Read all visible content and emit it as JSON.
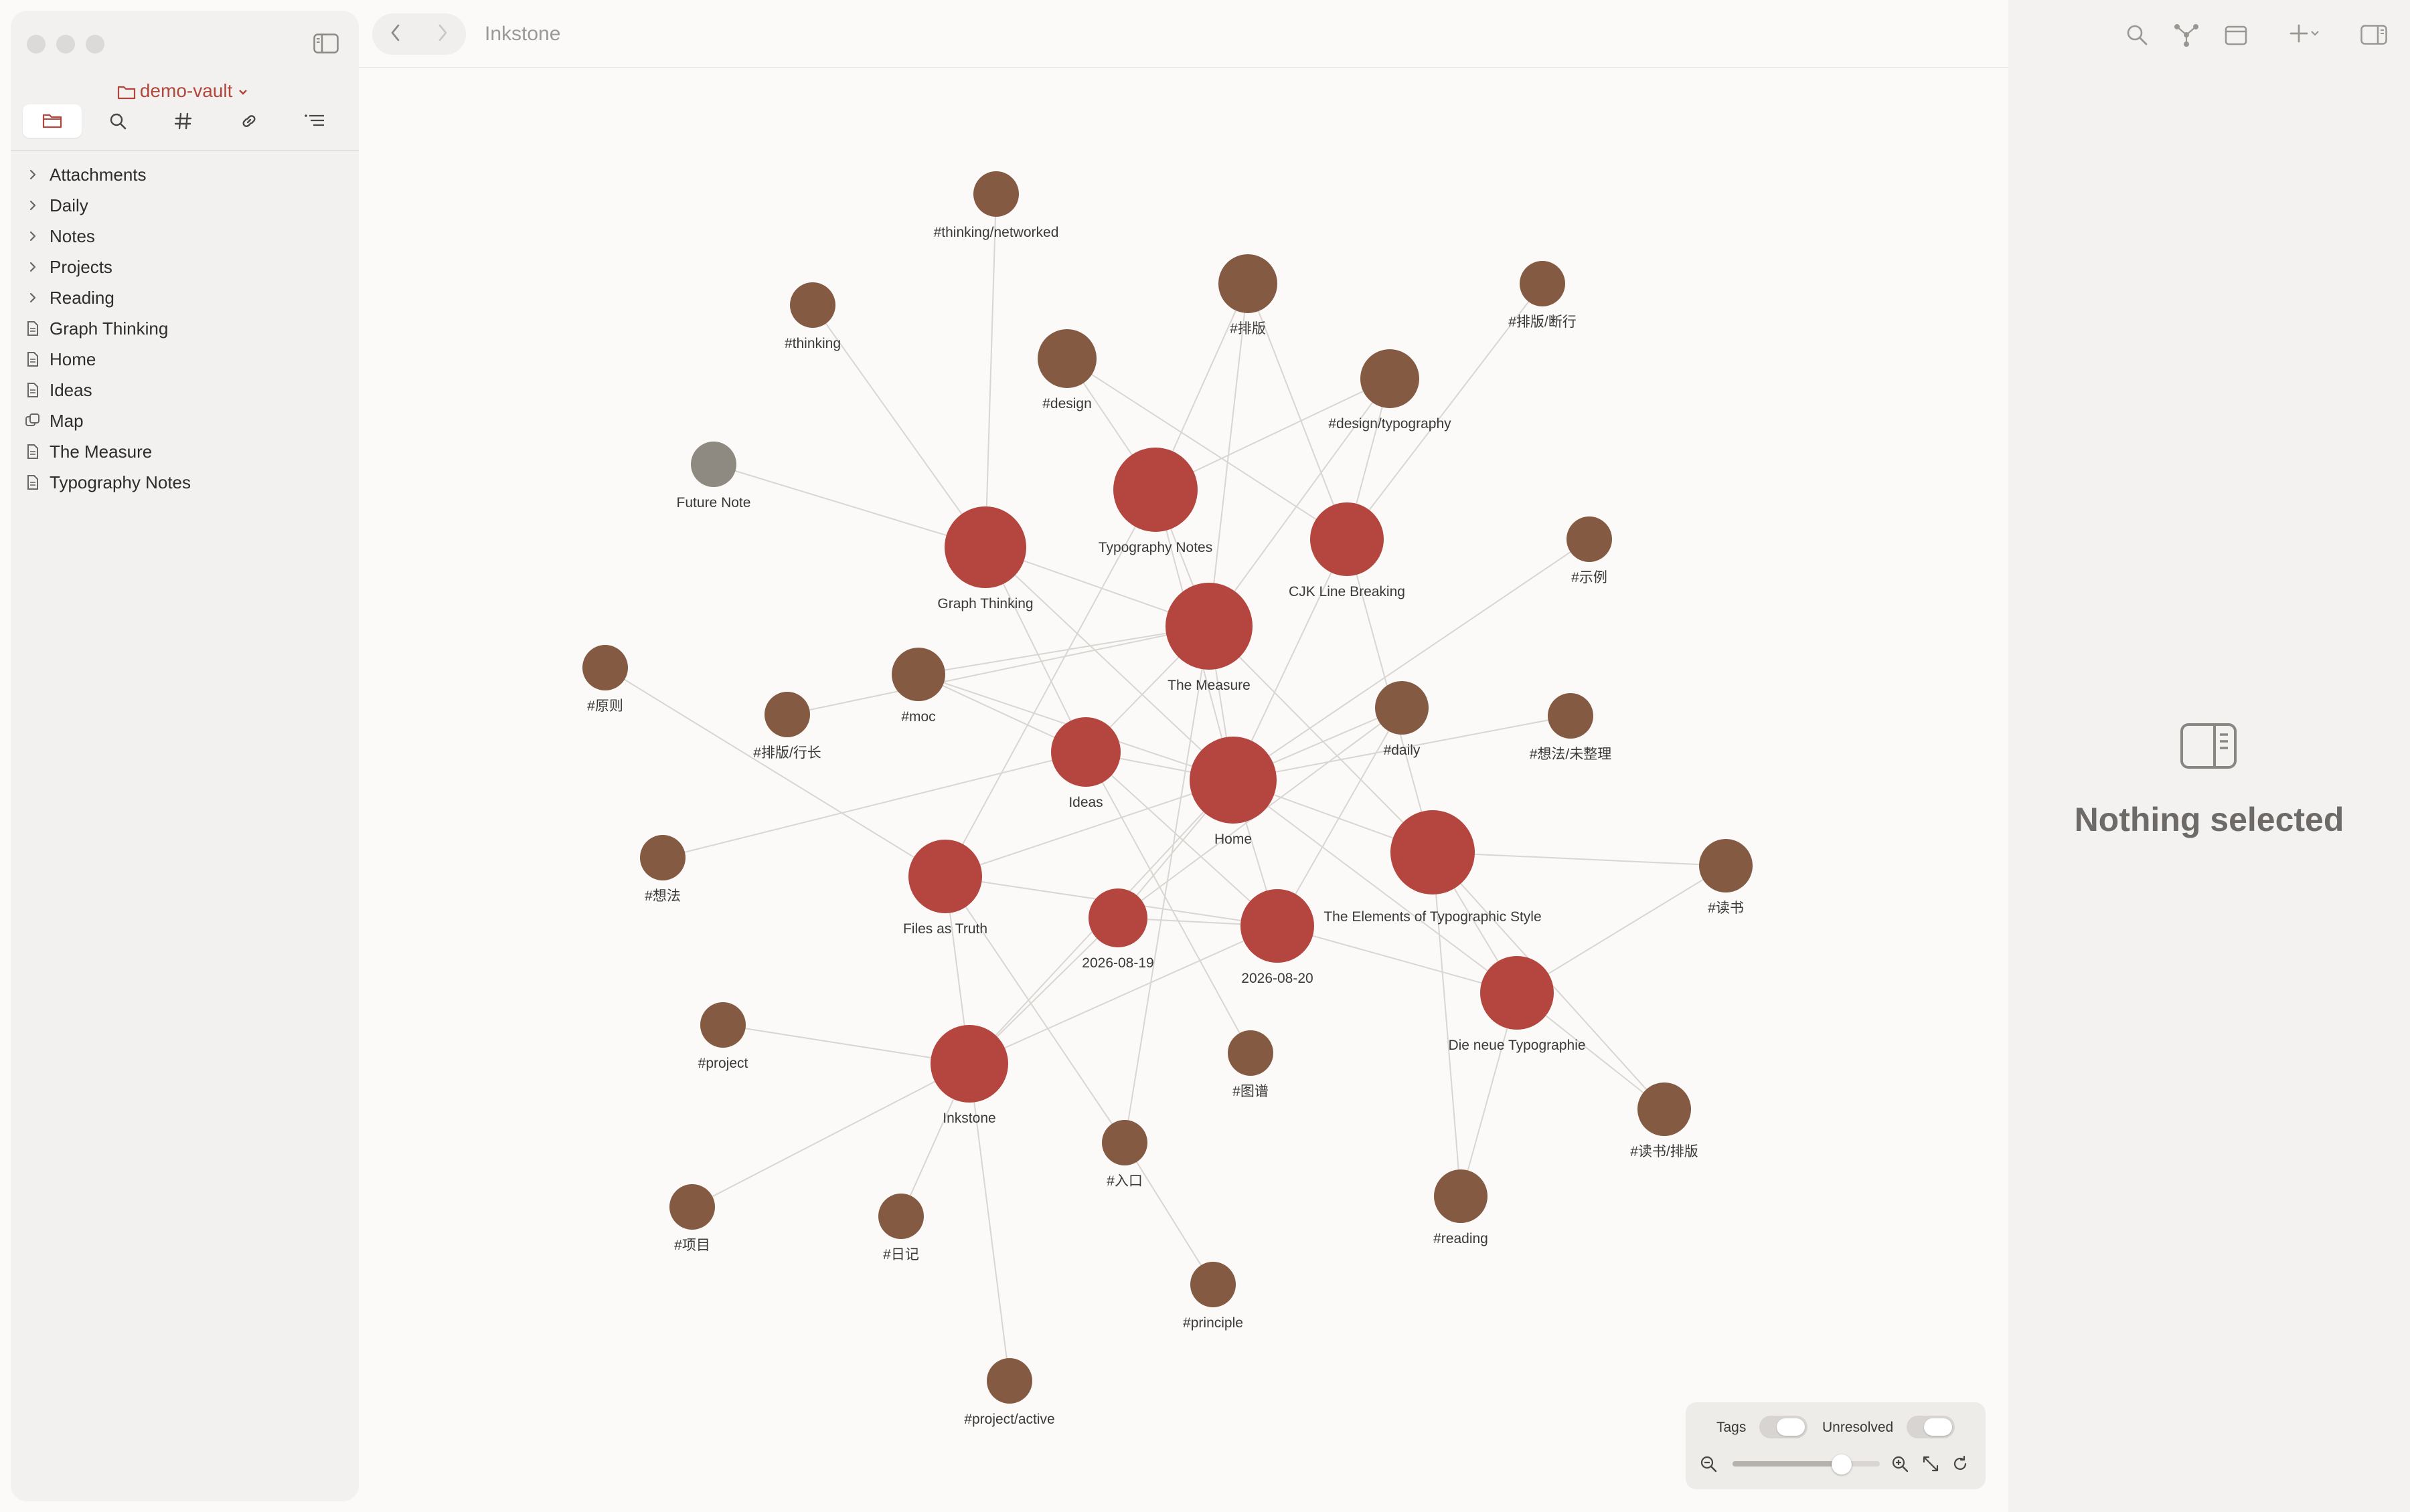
{
  "app": {
    "title": "Inkstone"
  },
  "sidebar": {
    "vault_name": "demo-vault",
    "tabs": [
      {
        "id": "files",
        "icon": "folder-icon",
        "active": true
      },
      {
        "id": "search",
        "icon": "search-icon",
        "active": false
      },
      {
        "id": "tags",
        "icon": "hash-icon",
        "active": false
      },
      {
        "id": "links",
        "icon": "link-icon",
        "active": false
      },
      {
        "id": "outline",
        "icon": "outline-icon",
        "active": false
      }
    ],
    "items": [
      {
        "label": "Attachments",
        "type": "folder"
      },
      {
        "label": "Daily",
        "type": "folder"
      },
      {
        "label": "Notes",
        "type": "folder"
      },
      {
        "label": "Projects",
        "type": "folder"
      },
      {
        "label": "Reading",
        "type": "folder"
      },
      {
        "label": "Graph Thinking",
        "type": "file"
      },
      {
        "label": "Home",
        "type": "file"
      },
      {
        "label": "Ideas",
        "type": "file"
      },
      {
        "label": "Map",
        "type": "canvas"
      },
      {
        "label": "The Measure",
        "type": "file"
      },
      {
        "label": "Typography Notes",
        "type": "file"
      }
    ]
  },
  "right_panel": {
    "empty_text": "Nothing selected"
  },
  "graph_controls": {
    "tags_label": "Tags",
    "unresolved_label": "Unresolved",
    "tags_on": false,
    "unresolved_on": false,
    "zoom_level": 0.74
  },
  "colors": {
    "note": "#b5453f",
    "tag": "#845a42",
    "unresolved": "#8e8a82",
    "edge": "#d9d6d2",
    "accent": "#b0463c"
  },
  "graph": {
    "nodes": [
      {
        "id": "thinking-networked",
        "label": "#thinking/networked",
        "kind": "tag"
      },
      {
        "id": "thinking",
        "label": "#thinking",
        "kind": "tag"
      },
      {
        "id": "paiban",
        "label": "#排版",
        "kind": "tag"
      },
      {
        "id": "paiban-duanxing",
        "label": "#排版/断行",
        "kind": "tag"
      },
      {
        "id": "design",
        "label": "#design",
        "kind": "tag"
      },
      {
        "id": "design-typography",
        "label": "#design/typography",
        "kind": "tag"
      },
      {
        "id": "future-note",
        "label": "Future Note",
        "kind": "unresolved"
      },
      {
        "id": "typography-notes",
        "label": "Typography Notes",
        "kind": "note"
      },
      {
        "id": "graph-thinking",
        "label": "Graph Thinking",
        "kind": "note"
      },
      {
        "id": "cjk-line-breaking",
        "label": "CJK Line Breaking",
        "kind": "note"
      },
      {
        "id": "shili",
        "label": "#示例",
        "kind": "tag"
      },
      {
        "id": "the-measure",
        "label": "The Measure",
        "kind": "note"
      },
      {
        "id": "yuanze",
        "label": "#原则",
        "kind": "tag"
      },
      {
        "id": "moc",
        "label": "#moc",
        "kind": "tag"
      },
      {
        "id": "paiban-hangchang",
        "label": "#排版/行长",
        "kind": "tag"
      },
      {
        "id": "daily",
        "label": "#daily",
        "kind": "tag"
      },
      {
        "id": "xiangfa-weizhengli",
        "label": "#想法/未整理",
        "kind": "tag"
      },
      {
        "id": "ideas",
        "label": "Ideas",
        "kind": "note"
      },
      {
        "id": "home",
        "label": "Home",
        "kind": "note"
      },
      {
        "id": "elements",
        "label": "The Elements of Typographic Style",
        "kind": "note"
      },
      {
        "id": "xiangfa",
        "label": "#想法",
        "kind": "tag"
      },
      {
        "id": "files-as-truth",
        "label": "Files as Truth",
        "kind": "note"
      },
      {
        "id": "d0819",
        "label": "2026-08-19",
        "kind": "note"
      },
      {
        "id": "d0820",
        "label": "2026-08-20",
        "kind": "note"
      },
      {
        "id": "dushu",
        "label": "#读书",
        "kind": "tag"
      },
      {
        "id": "die-neue",
        "label": "Die neue Typographie",
        "kind": "note"
      },
      {
        "id": "project",
        "label": "#project",
        "kind": "tag"
      },
      {
        "id": "tupu",
        "label": "#图谱",
        "kind": "tag"
      },
      {
        "id": "inkstone",
        "label": "Inkstone",
        "kind": "note"
      },
      {
        "id": "rukou",
        "label": "#入口",
        "kind": "tag"
      },
      {
        "id": "dushu-paiban",
        "label": "#读书/排版",
        "kind": "tag"
      },
      {
        "id": "reading",
        "label": "#reading",
        "kind": "tag"
      },
      {
        "id": "xiangmu",
        "label": "#项目",
        "kind": "tag"
      },
      {
        "id": "riji",
        "label": "#日记",
        "kind": "tag"
      },
      {
        "id": "principle",
        "label": "#principle",
        "kind": "tag"
      },
      {
        "id": "project-active",
        "label": "#project/active",
        "kind": "tag"
      }
    ],
    "edges": [
      [
        "graph-thinking",
        "thinking-networked"
      ],
      [
        "graph-thinking",
        "thinking"
      ],
      [
        "graph-thinking",
        "future-note"
      ],
      [
        "graph-thinking",
        "the-measure"
      ],
      [
        "graph-thinking",
        "ideas"
      ],
      [
        "graph-thinking",
        "home"
      ],
      [
        "typography-notes",
        "design"
      ],
      [
        "typography-notes",
        "design-typography"
      ],
      [
        "typography-notes",
        "paiban"
      ],
      [
        "typography-notes",
        "files-as-truth"
      ],
      [
        "typography-notes",
        "home"
      ],
      [
        "typography-notes",
        "the-measure"
      ],
      [
        "cjk-line-breaking",
        "paiban"
      ],
      [
        "cjk-line-breaking",
        "paiban-duanxing"
      ],
      [
        "cjk-line-breaking",
        "design"
      ],
      [
        "cjk-line-breaking",
        "design-typography"
      ],
      [
        "cjk-line-breaking",
        "home"
      ],
      [
        "cjk-line-breaking",
        "elements"
      ],
      [
        "the-measure",
        "paiban"
      ],
      [
        "the-measure",
        "paiban-hangchang"
      ],
      [
        "the-measure",
        "moc"
      ],
      [
        "the-measure",
        "design-typography"
      ],
      [
        "the-measure",
        "home"
      ],
      [
        "the-measure",
        "ideas"
      ],
      [
        "the-measure",
        "elements"
      ],
      [
        "home",
        "moc"
      ],
      [
        "home",
        "daily"
      ],
      [
        "home",
        "xiangfa-weizhengli"
      ],
      [
        "home",
        "shili"
      ],
      [
        "home",
        "ideas"
      ],
      [
        "home",
        "elements"
      ],
      [
        "home",
        "d0819"
      ],
      [
        "home",
        "d0820"
      ],
      [
        "home",
        "inkstone"
      ],
      [
        "home",
        "files-as-truth"
      ],
      [
        "home",
        "die-neue"
      ],
      [
        "ideas",
        "moc"
      ],
      [
        "ideas",
        "xiangfa"
      ],
      [
        "ideas",
        "tupu"
      ],
      [
        "ideas",
        "d0820"
      ],
      [
        "yuanze",
        "files-as-truth"
      ],
      [
        "files-as-truth",
        "inkstone"
      ],
      [
        "files-as-truth",
        "rukou"
      ],
      [
        "files-as-truth",
        "d0820"
      ],
      [
        "d0819",
        "inkstone"
      ],
      [
        "d0819",
        "d0820"
      ],
      [
        "d0819",
        "daily"
      ],
      [
        "d0820",
        "daily"
      ],
      [
        "d0820",
        "die-neue"
      ],
      [
        "d0820",
        "inkstone"
      ],
      [
        "elements",
        "dushu"
      ],
      [
        "elements",
        "die-neue"
      ],
      [
        "elements",
        "reading"
      ],
      [
        "elements",
        "dushu-paiban"
      ],
      [
        "die-neue",
        "dushu"
      ],
      [
        "die-neue",
        "reading"
      ],
      [
        "die-neue",
        "dushu-paiban"
      ],
      [
        "inkstone",
        "project"
      ],
      [
        "inkstone",
        "xiangmu"
      ],
      [
        "inkstone",
        "riji"
      ],
      [
        "inkstone",
        "project-active"
      ],
      [
        "rukou",
        "principle"
      ],
      [
        "rukou",
        "the-measure"
      ]
    ]
  }
}
